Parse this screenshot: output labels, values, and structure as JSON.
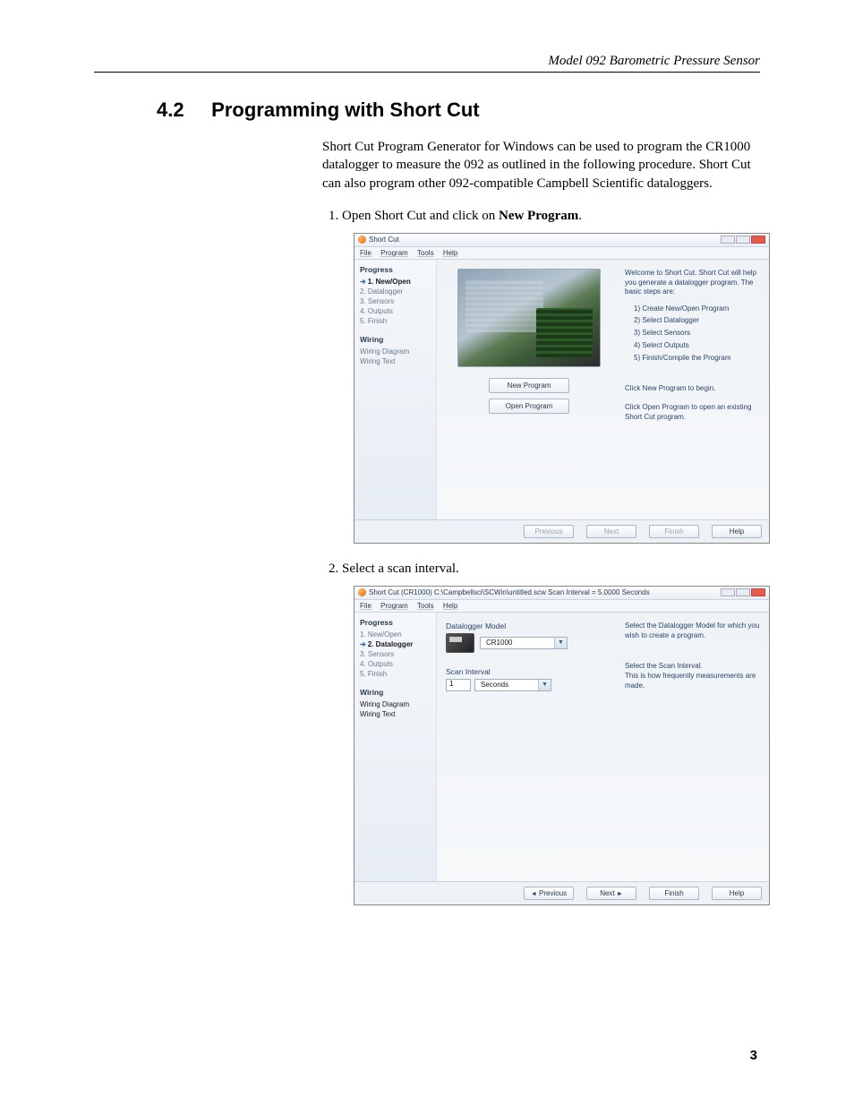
{
  "header": {
    "title": "Model 092 Barometric Pressure Sensor"
  },
  "section": {
    "number": "4.2",
    "title": "Programming with Short Cut",
    "intro": "Short Cut Program Generator for Windows can be used to program the CR1000 datalogger to measure the 092 as outlined in the following procedure. Short Cut can also program other 092-compatible Campbell Scientific dataloggers."
  },
  "steps": {
    "s1_pre": "Open Short Cut and click on ",
    "s1_bold": "New Program",
    "s1_post": ".",
    "s2": "Select a scan interval."
  },
  "page_number": "3",
  "shared": {
    "menubar": {
      "file": "File",
      "program": "Program",
      "tools": "Tools",
      "help": "Help"
    },
    "sidebar": {
      "progress_title": "Progress",
      "items": [
        {
          "label": "1. New/Open"
        },
        {
          "label": "2. Datalogger"
        },
        {
          "label": "3. Sensors"
        },
        {
          "label": "4. Outputs"
        },
        {
          "label": "5. Finish"
        }
      ],
      "wiring_title": "Wiring",
      "wiring_items": [
        {
          "label": "Wiring Diagram"
        },
        {
          "label": "Wiring Text"
        }
      ]
    },
    "footer": {
      "previous": "Previous",
      "next": "Next",
      "finish": "Finish",
      "help": "Help"
    }
  },
  "ss1": {
    "title": "Short Cut",
    "btn_new": "New Program",
    "btn_open": "Open Program",
    "welcome": "Welcome to Short Cut.  Short Cut will help you generate a datalogger program.  The basic steps are:",
    "rsteps": [
      "1) Create New/Open Program",
      "2) Select Datalogger",
      "3) Select Sensors",
      "4) Select Outputs",
      "5) Finish/Compile the Program"
    ],
    "hint1": "Click New Program to begin.",
    "hint2": "Click Open Program to open an existing Short Cut program."
  },
  "ss2": {
    "title": "Short Cut (CR1000) C:\\Campbellsci\\SCWin\\untitled.scw      Scan Interval = 5.0000 Seconds",
    "model_label": "Datalogger Model",
    "model_value": "CR1000",
    "scan_label": "Scan Interval",
    "scan_value": "1",
    "scan_units": "Seconds",
    "r1": "Select the Datalogger Model for which you wish to create a program.",
    "r2": "Select the Scan Interval.",
    "r3": "This is how frequently measurements are made."
  },
  "nav_glyphs": {
    "left": "◄",
    "right": "►",
    "down": "▼"
  }
}
